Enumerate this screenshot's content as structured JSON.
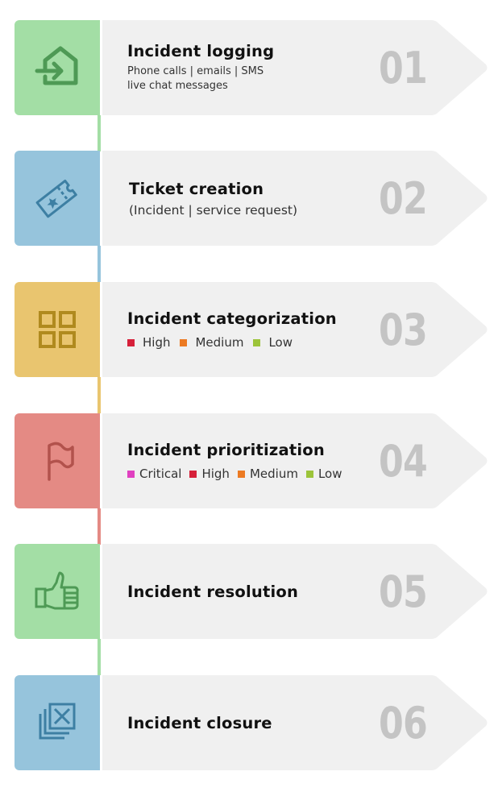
{
  "steps": [
    {
      "number": "01",
      "title": "Incident logging",
      "subtitle_lines": [
        "Phone calls | emails | SMS",
        "live chat messages"
      ],
      "icon": "house-enter-icon",
      "tile_color": "#a3dea5",
      "icon_color": "#4e9a55"
    },
    {
      "number": "02",
      "title": "Ticket creation",
      "subtitle": "(Incident | service request)",
      "icon": "ticket-icon",
      "tile_color": "#96c4dc",
      "icon_color": "#3d7fa3"
    },
    {
      "number": "03",
      "title": "Incident categorization",
      "legend": [
        {
          "label": "High",
          "color": "#d6203a"
        },
        {
          "label": "Medium",
          "color": "#ec7a22"
        },
        {
          "label": "Low",
          "color": "#9cc43a"
        }
      ],
      "icon": "grid-icon",
      "tile_color": "#e9c56f",
      "icon_color": "#b08a1e"
    },
    {
      "number": "04",
      "title": "Incident prioritization",
      "legend": [
        {
          "label": "Critical",
          "color": "#e040c0"
        },
        {
          "label": "High",
          "color": "#d6203a"
        },
        {
          "label": "Medium",
          "color": "#ec7a22"
        },
        {
          "label": "Low",
          "color": "#9cc43a"
        }
      ],
      "icon": "flag-icon",
      "tile_color": "#e48a84",
      "icon_color": "#b2524c"
    },
    {
      "number": "05",
      "title": "Incident resolution",
      "icon": "thumbs-up-icon",
      "tile_color": "#a3dea5",
      "icon_color": "#4e9a55"
    },
    {
      "number": "06",
      "title": "Incident closure",
      "icon": "close-stack-icon",
      "tile_color": "#96c4dc",
      "icon_color": "#3d7fa3"
    }
  ],
  "card_color": "#f0f0f0",
  "number_color": "#c4c4c4"
}
